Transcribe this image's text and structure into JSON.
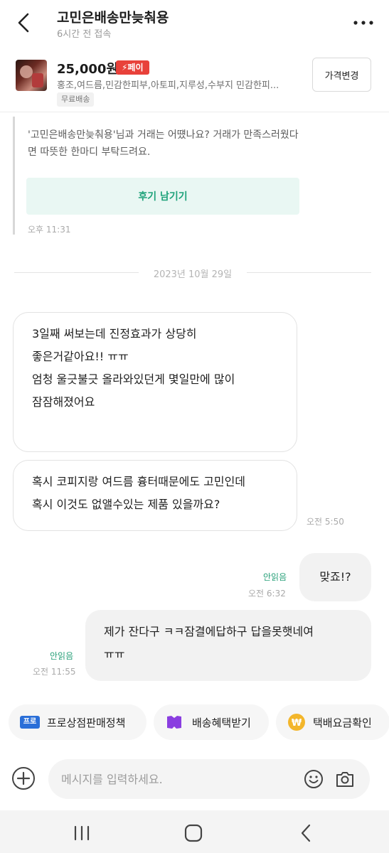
{
  "header": {
    "title": "고민은배송만늦춰용",
    "subtitle": "6시간 전 접속"
  },
  "product": {
    "price": "25,000원",
    "pay_badge": "⚡페이",
    "description": "홍조,여드름,민감한피부,아토피,지루성,수부지 민감한피...",
    "shipping_tag": "무료배송",
    "price_change_button": "가격변경"
  },
  "review_request": {
    "text": "'고민은배송만늦춰용'님과 거래는 어떘나요? 거래가 만족스러웠다면 따뜻한 한마디 부탁드려요.",
    "button": "후기 남기기",
    "time": "오후 11:31"
  },
  "date_divider": "2023년 10월 29일",
  "messages": {
    "incoming_1": [
      "3일째 써보는데 진정효과가 상당히",
      "좋은거같아요!! ㅠㅠ",
      "엄청 울긋불긋 올라와있던게 몇일만에 많이",
      "잠잠해졌어요"
    ],
    "incoming_2": [
      "혹시 코피지랑 여드름 흉터때문에도 고민인데",
      "혹시 이것도 없앨수있는 제품 있을까요?"
    ],
    "incoming_time": "오전 5:50",
    "outgoing_1": "맞죠!?",
    "outgoing_1_status": "안읽음",
    "outgoing_1_time": "오전 6:32",
    "outgoing_2": [
      "제가 잔다구 ㅋㅋ잠결에답하구 답을못햇네여",
      "ㅠㅠ"
    ],
    "outgoing_2_status": "안읽음",
    "outgoing_2_time": "오전 11:55"
  },
  "quick_actions": {
    "pro_badge": "프로",
    "policy": "프로상점판매정책",
    "shipping_benefit": "배송혜택받기",
    "fee_check": "택배요금확인",
    "coin_symbol": "₩"
  },
  "input": {
    "placeholder": "메시지를 입력하세요."
  },
  "colors": {
    "accent_green": "#1fa37b",
    "pay_red": "#e8413a",
    "pro_blue": "#2a6fd8",
    "ship_purple": "#8a3ee0",
    "coin_yellow": "#f3b62b"
  },
  "icons": {
    "back": "chevron-left-icon",
    "more": "more-horizontal-icon",
    "plus": "plus-circle-icon",
    "emoji": "smiley-icon",
    "camera": "camera-icon",
    "ship": "truck-icon",
    "coin": "won-coin-icon"
  }
}
